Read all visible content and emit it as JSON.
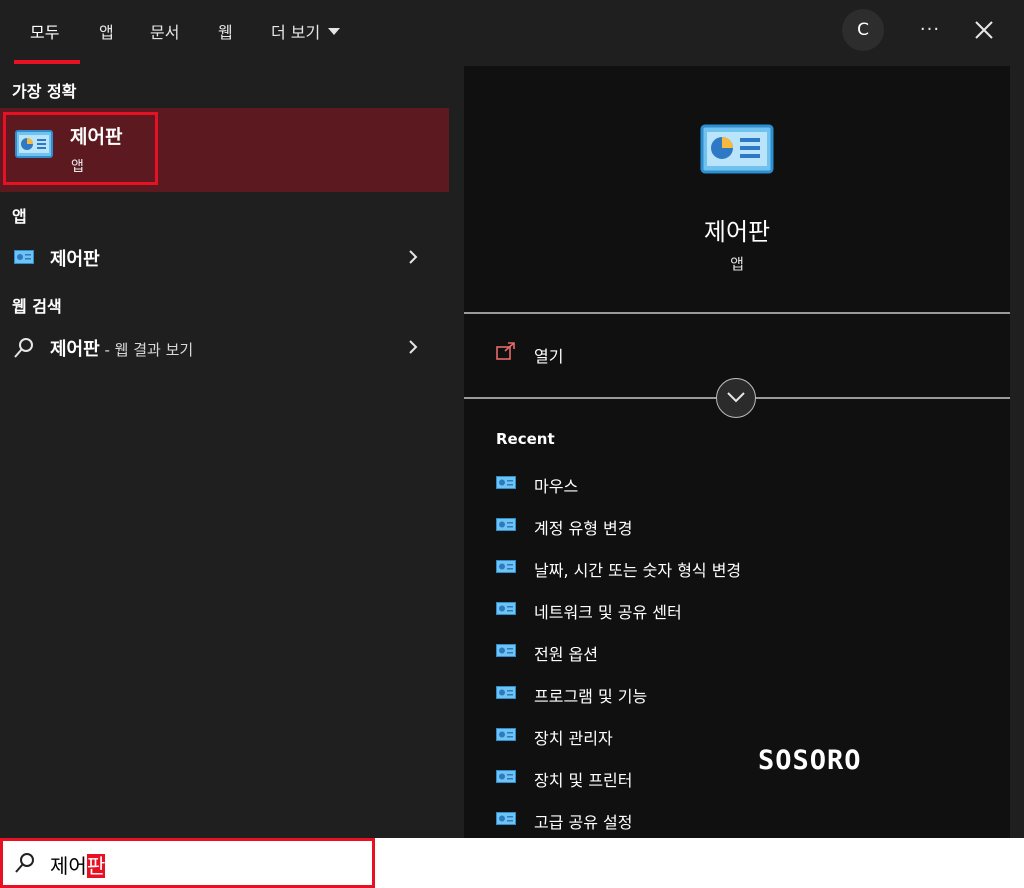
{
  "tabs": [
    {
      "label": "모두",
      "active": true
    },
    {
      "label": "앱"
    },
    {
      "label": "문서"
    },
    {
      "label": "웹"
    },
    {
      "label": "더 보기"
    }
  ],
  "header": {
    "avatar_letter": "C",
    "more_label": "···"
  },
  "left": {
    "best_match_heading": "가장 정확",
    "best_match": {
      "title": "제어판",
      "subtitle": "앱",
      "icon": "control-panel-icon"
    },
    "apps_heading": "앱",
    "app_result": {
      "label": "제어판",
      "icon": "control-panel-icon"
    },
    "web_heading": "웹 검색",
    "web_result": {
      "label": "제어판",
      "suffix": " - 웹 결과 보기",
      "icon": "search-icon"
    }
  },
  "preview": {
    "title": "제어판",
    "subtitle": "앱",
    "open_label": "열기",
    "recent_heading": "Recent",
    "recent_items": [
      "마우스",
      "계정 유형 변경",
      "날짜, 시간 또는 숫자 형식 변경",
      "네트워크 및 공유 센터",
      "전원 옵션",
      "프로그램 및 기능",
      "장치 관리자",
      "장치 및 프린터",
      "고급 공유 설정"
    ]
  },
  "watermark": "SOSORO",
  "search": {
    "typed": "제어",
    "selected": "판"
  },
  "colors": {
    "accent": "#e81123",
    "selected_bg": "#5c1a20",
    "pane_bg": "#1f1f1f",
    "preview_bg": "#101010"
  }
}
